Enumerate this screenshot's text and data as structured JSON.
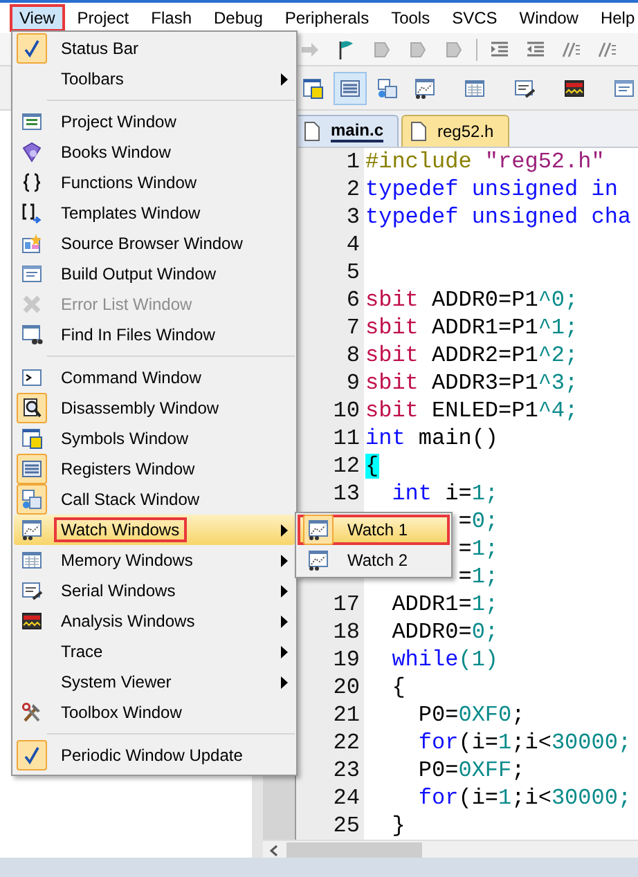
{
  "menubar": [
    {
      "label": "View",
      "selected": true,
      "annotated": true
    },
    {
      "label": "Project",
      "selected": false,
      "annotated": false
    },
    {
      "label": "Flash",
      "selected": false,
      "annotated": false
    },
    {
      "label": "Debug",
      "selected": false,
      "annotated": false
    },
    {
      "label": "Peripherals",
      "selected": false,
      "annotated": false
    },
    {
      "label": "Tools",
      "selected": false,
      "annotated": false
    },
    {
      "label": "SVCS",
      "selected": false,
      "annotated": false
    },
    {
      "label": "Window",
      "selected": false,
      "annotated": false
    },
    {
      "label": "Help",
      "selected": false,
      "annotated": false
    }
  ],
  "view_menu": [
    {
      "kind": "item",
      "label": "Status Bar",
      "checked": true,
      "disabled": false,
      "submenu": false,
      "selected": false,
      "annotated": false
    },
    {
      "kind": "item",
      "label": "Toolbars",
      "checked": false,
      "disabled": false,
      "submenu": true,
      "selected": false,
      "annotated": false
    },
    {
      "kind": "separator"
    },
    {
      "kind": "item",
      "label": "Project Window",
      "checked": false,
      "disabled": false,
      "submenu": false,
      "selected": false,
      "annotated": false
    },
    {
      "kind": "item",
      "label": "Books Window",
      "checked": false,
      "disabled": false,
      "submenu": false,
      "selected": false,
      "annotated": false
    },
    {
      "kind": "item",
      "label": "Functions Window",
      "checked": false,
      "disabled": false,
      "submenu": false,
      "selected": false,
      "annotated": false
    },
    {
      "kind": "item",
      "label": "Templates Window",
      "checked": false,
      "disabled": false,
      "submenu": false,
      "selected": false,
      "annotated": false
    },
    {
      "kind": "item",
      "label": "Source Browser Window",
      "checked": false,
      "disabled": false,
      "submenu": false,
      "selected": false,
      "annotated": false
    },
    {
      "kind": "item",
      "label": "Build Output Window",
      "checked": false,
      "disabled": false,
      "submenu": false,
      "selected": false,
      "annotated": false
    },
    {
      "kind": "item",
      "label": "Error List Window",
      "checked": false,
      "disabled": true,
      "submenu": false,
      "selected": false,
      "annotated": false
    },
    {
      "kind": "item",
      "label": "Find In Files Window",
      "checked": false,
      "disabled": false,
      "submenu": false,
      "selected": false,
      "annotated": false
    },
    {
      "kind": "separator"
    },
    {
      "kind": "item",
      "label": "Command Window",
      "checked": false,
      "disabled": false,
      "submenu": false,
      "selected": false,
      "annotated": false
    },
    {
      "kind": "item",
      "label": "Disassembly Window",
      "checked": true,
      "disabled": false,
      "submenu": false,
      "selected": false,
      "annotated": false
    },
    {
      "kind": "item",
      "label": "Symbols Window",
      "checked": false,
      "disabled": false,
      "submenu": false,
      "selected": false,
      "annotated": false
    },
    {
      "kind": "item",
      "label": "Registers Window",
      "checked": true,
      "disabled": false,
      "submenu": false,
      "selected": false,
      "annotated": false
    },
    {
      "kind": "item",
      "label": "Call Stack Window",
      "checked": true,
      "disabled": false,
      "submenu": false,
      "selected": false,
      "annotated": false
    },
    {
      "kind": "item",
      "label": "Watch Windows",
      "checked": false,
      "disabled": false,
      "submenu": true,
      "selected": true,
      "annotated": true
    },
    {
      "kind": "item",
      "label": "Memory Windows",
      "checked": false,
      "disabled": false,
      "submenu": true,
      "selected": false,
      "annotated": false
    },
    {
      "kind": "item",
      "label": "Serial Windows",
      "checked": false,
      "disabled": false,
      "submenu": true,
      "selected": false,
      "annotated": false
    },
    {
      "kind": "item",
      "label": "Analysis Windows",
      "checked": false,
      "disabled": false,
      "submenu": true,
      "selected": false,
      "annotated": false
    },
    {
      "kind": "item",
      "label": "Trace",
      "checked": false,
      "disabled": false,
      "submenu": true,
      "selected": false,
      "annotated": false
    },
    {
      "kind": "item",
      "label": "System Viewer",
      "checked": false,
      "disabled": false,
      "submenu": true,
      "selected": false,
      "annotated": false
    },
    {
      "kind": "item",
      "label": "Toolbox Window",
      "checked": false,
      "disabled": false,
      "submenu": false,
      "selected": false,
      "annotated": false
    },
    {
      "kind": "separator"
    },
    {
      "kind": "item",
      "label": "Periodic Window Update",
      "checked": true,
      "disabled": false,
      "submenu": false,
      "selected": false,
      "annotated": false
    }
  ],
  "watch_submenu": [
    {
      "label": "Watch 1",
      "selected": true,
      "annotated": true
    },
    {
      "label": "Watch 2",
      "selected": false,
      "annotated": false
    }
  ],
  "tabs": [
    {
      "label": "main.c",
      "selected": true
    },
    {
      "label": "reg52.h",
      "selected": false
    }
  ],
  "code_lines": [
    {
      "number": "1",
      "tokens": [
        {
          "text": "#include ",
          "kind": "preprocessor"
        },
        {
          "text": "\"reg52.h\"",
          "kind": "string"
        }
      ]
    },
    {
      "number": "2",
      "tokens": [
        {
          "text": "typedef unsigned in",
          "kind": "keyword"
        }
      ]
    },
    {
      "number": "3",
      "tokens": [
        {
          "text": "typedef unsigned cha",
          "kind": "keyword"
        }
      ]
    },
    {
      "number": "4"
    },
    {
      "number": "5"
    },
    {
      "number": "6",
      "tokens": [
        {
          "text": "sbit",
          "kind": "type"
        },
        {
          "text": " ADDR0=P1",
          "kind": "plain"
        },
        {
          "text": "^0;",
          "kind": "number"
        }
      ]
    },
    {
      "number": "7",
      "tokens": [
        {
          "text": "sbit",
          "kind": "type"
        },
        {
          "text": " ADDR1=P1",
          "kind": "plain"
        },
        {
          "text": "^1;",
          "kind": "number"
        }
      ]
    },
    {
      "number": "8",
      "tokens": [
        {
          "text": "sbit",
          "kind": "type"
        },
        {
          "text": " ADDR2=P1",
          "kind": "plain"
        },
        {
          "text": "^2;",
          "kind": "number"
        }
      ]
    },
    {
      "number": "9",
      "tokens": [
        {
          "text": "sbit",
          "kind": "type"
        },
        {
          "text": " ADDR3=P1",
          "kind": "plain"
        },
        {
          "text": "^3;",
          "kind": "number"
        }
      ]
    },
    {
      "number": "10",
      "tokens": [
        {
          "text": "sbit",
          "kind": "type"
        },
        {
          "text": " ENLED=P1",
          "kind": "plain"
        },
        {
          "text": "^4;",
          "kind": "number"
        }
      ]
    },
    {
      "number": "11",
      "tokens": [
        {
          "text": "int",
          "kind": "keyword"
        },
        {
          "text": " main()",
          "kind": "plain"
        }
      ]
    },
    {
      "number": "12",
      "tokens": [
        {
          "text": "{",
          "kind": "brace_match"
        }
      ]
    },
    {
      "number": "13",
      "tokens": [
        {
          "text": "  int",
          "kind": "keyword"
        },
        {
          "text": " i=",
          "kind": "plain"
        },
        {
          "text": "1;",
          "kind": "number"
        }
      ]
    },
    {
      "tokens": [
        {
          "text": "       =",
          "kind": "plain"
        },
        {
          "text": "0;",
          "kind": "number"
        }
      ]
    },
    {
      "tokens": [
        {
          "text": "       =",
          "kind": "plain"
        },
        {
          "text": "1;",
          "kind": "number"
        }
      ]
    },
    {
      "tokens": [
        {
          "text": "       =",
          "kind": "plain"
        },
        {
          "text": "1;",
          "kind": "number"
        }
      ]
    },
    {
      "number": "17",
      "tokens": [
        {
          "text": "  ADDR1=",
          "kind": "plain"
        },
        {
          "text": "1;",
          "kind": "number"
        }
      ]
    },
    {
      "number": "18",
      "tokens": [
        {
          "text": "  ADDR0=",
          "kind": "plain"
        },
        {
          "text": "0;",
          "kind": "number"
        }
      ]
    },
    {
      "number": "19",
      "tokens": [
        {
          "text": "  while",
          "kind": "keyword"
        },
        {
          "text": "(1)",
          "kind": "number"
        }
      ]
    },
    {
      "number": "20",
      "tokens": [
        {
          "text": "  {",
          "kind": "plain"
        }
      ]
    },
    {
      "number": "21",
      "tokens": [
        {
          "text": "    P0=",
          "kind": "plain"
        },
        {
          "text": "0XF0",
          "kind": "number"
        },
        {
          "text": ";",
          "kind": "plain"
        }
      ]
    },
    {
      "number": "22",
      "tokens": [
        {
          "text": "    for",
          "kind": "keyword"
        },
        {
          "text": "(i=",
          "kind": "plain"
        },
        {
          "text": "1",
          "kind": "number"
        },
        {
          "text": ";i<",
          "kind": "plain"
        },
        {
          "text": "30000;",
          "kind": "number"
        }
      ]
    },
    {
      "number": "23",
      "tokens": [
        {
          "text": "    P0=",
          "kind": "plain"
        },
        {
          "text": "0XFF",
          "kind": "number"
        },
        {
          "text": ";",
          "kind": "plain"
        }
      ]
    },
    {
      "number": "24",
      "tokens": [
        {
          "text": "    for",
          "kind": "keyword"
        },
        {
          "text": "(i=",
          "kind": "plain"
        },
        {
          "text": "1",
          "kind": "number"
        },
        {
          "text": ";i<",
          "kind": "plain"
        },
        {
          "text": "30000;",
          "kind": "number"
        }
      ]
    },
    {
      "number": "25",
      "tokens": [
        {
          "text": "  }",
          "kind": "plain"
        }
      ]
    }
  ]
}
